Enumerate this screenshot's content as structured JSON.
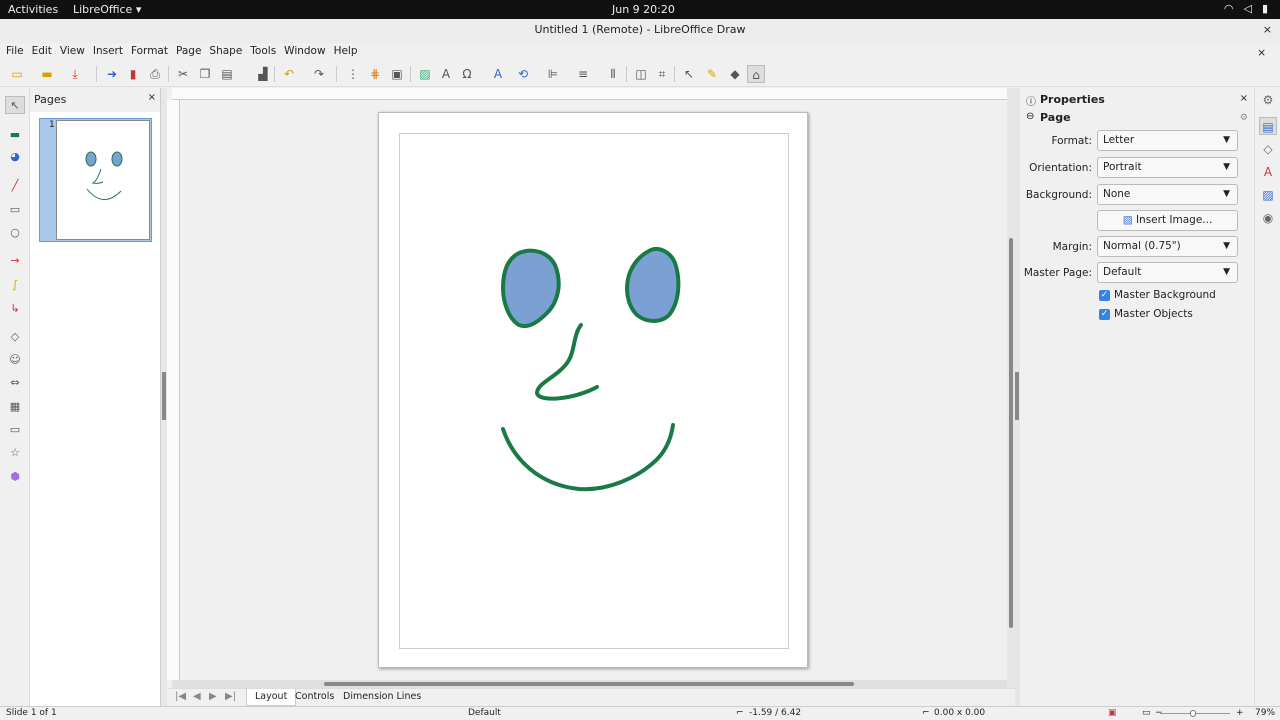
{
  "topbar": {
    "activities": "Activities",
    "app": "LibreOffice ▾",
    "clock": "Jun 9  20:20"
  },
  "window": {
    "title": "Untitled 1 (Remote) - LibreOffice Draw",
    "close": "×"
  },
  "menu": [
    "File",
    "Edit",
    "View",
    "Insert",
    "Format",
    "Page",
    "Shape",
    "Tools",
    "Window",
    "Help"
  ],
  "pages_panel": {
    "title": "Pages",
    "thumb_number": "1",
    "close": "×"
  },
  "properties": {
    "title": "Properties",
    "section": "Page",
    "format_label": "Format:",
    "format_value": "Letter",
    "orientation_label": "Orientation:",
    "orientation_value": "Portrait",
    "background_label": "Background:",
    "background_value": "None",
    "insert_image": "Insert Image...",
    "margin_label": "Margin:",
    "margin_value": "Normal (0.75\")",
    "master_page_label": "Master Page:",
    "master_page_value": "Default",
    "master_background": "Master Background",
    "master_objects": "Master Objects"
  },
  "tabs": [
    "Layout",
    "Controls",
    "Dimension Lines"
  ],
  "status": {
    "slide": "Slide 1 of 1",
    "layout": "Default",
    "position": "-1.59 / 6.42",
    "size": "0.00 x 0.00",
    "zoom": "79%"
  },
  "colors": {
    "face_fill": "#7ba0d4",
    "face_stroke": "#1a7a44",
    "accent": "#3584e4"
  }
}
